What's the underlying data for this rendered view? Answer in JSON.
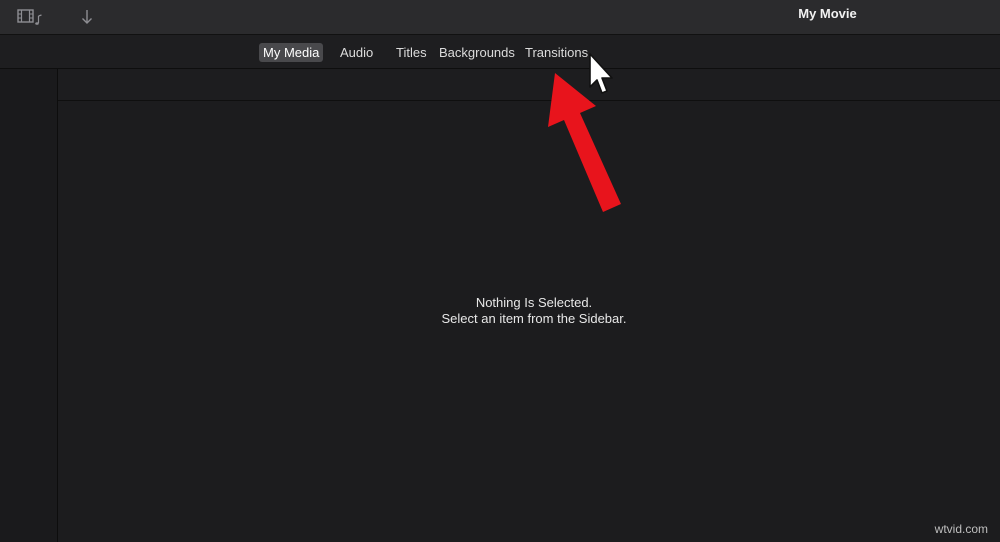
{
  "window": {
    "title": "My Movie"
  },
  "toolbar": {
    "media_icon": "film-music-icon",
    "import_icon": "download-arrow-icon"
  },
  "tabs": [
    {
      "label": "My Media",
      "active": true
    },
    {
      "label": "Audio",
      "active": false
    },
    {
      "label": "Titles",
      "active": false
    },
    {
      "label": "Backgrounds",
      "active": false
    },
    {
      "label": "Transitions",
      "active": false
    }
  ],
  "browser": {
    "empty_title": "Nothing Is Selected.",
    "empty_subtitle": "Select an item from the Sidebar."
  },
  "annotation": {
    "arrow_color": "#e8141c",
    "cursor_icon": "mouse-pointer-icon"
  },
  "watermark": "wtvid.com"
}
